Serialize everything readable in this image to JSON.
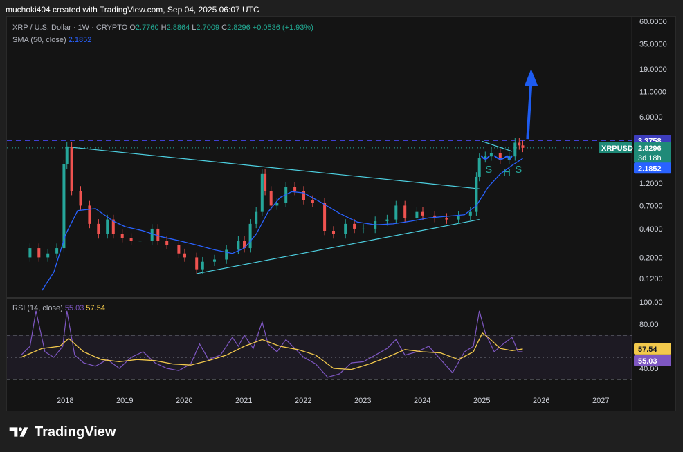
{
  "header": {
    "attribution": "muchoki404 created with TradingView.com, Sep 04, 2025 06:07 UTC"
  },
  "legend": {
    "symbol": "XRP / U.S. Dollar · 1W · CRYPTO",
    "o_label": "O",
    "o": "2.7760",
    "h_label": "H",
    "h": "2.8864",
    "l_label": "L",
    "l": "2.7009",
    "c_label": "C",
    "c": "2.8296",
    "change": "+0.0536 (+1.93%)",
    "sma_label": "SMA (50, close)",
    "sma": "2.1852"
  },
  "rsi_legend": {
    "label": "RSI (14, close)",
    "rsi": "55.03",
    "ma": "57.54"
  },
  "price_badges": {
    "resistance": "3.3758",
    "symbol": "XRPUSD",
    "price": "2.8296",
    "countdown": "3d 18h",
    "sma": "2.1852"
  },
  "rsi_badges": {
    "ma": "57.54",
    "rsi": "55.03"
  },
  "pattern_labels": [
    "S",
    "H",
    "S"
  ],
  "footer": {
    "brand": "TradingView"
  },
  "colors": {
    "up": "#26a69a",
    "down": "#ef5350",
    "sma": "#2962ff",
    "trend": "#4dd0e1",
    "rsi": "#7e57c2",
    "rsi_ma": "#f2c94c",
    "resistance": "#3f3fd1",
    "arrow": "#1e5cf0"
  },
  "chart_data": [
    {
      "type": "candlestick",
      "title": "XRP / U.S. Dollar · 1W · CRYPTO",
      "y_scale": "log",
      "y_ticks": [
        "60.0000",
        "35.0000",
        "19.0000",
        "11.0000",
        "6.0000",
        "1.2000",
        "0.7000",
        "0.4000",
        "0.2000",
        "0.1200"
      ],
      "x_ticks": [
        "2018",
        "2019",
        "2020",
        "2021",
        "2022",
        "2023",
        "2024",
        "2025",
        "2026",
        "2027"
      ],
      "series": [
        {
          "name": "XRP / U.S. Dollar",
          "x": [
            2017.25,
            2017.4,
            2017.55,
            2017.7,
            2017.85,
            2017.97,
            2018.02,
            2018.1,
            2018.25,
            2018.4,
            2018.55,
            2018.7,
            2018.8,
            2018.95,
            2019.1,
            2019.25,
            2019.45,
            2019.55,
            2019.7,
            2019.9,
            2020.0,
            2020.2,
            2020.3,
            2020.5,
            2020.7,
            2020.9,
            2021.0,
            2021.1,
            2021.2,
            2021.3,
            2021.35,
            2021.45,
            2021.55,
            2021.7,
            2021.85,
            2022.0,
            2022.15,
            2022.35,
            2022.5,
            2022.7,
            2022.85,
            2023.0,
            2023.2,
            2023.4,
            2023.55,
            2023.7,
            2023.9,
            2024.0,
            2024.2,
            2024.4,
            2024.6,
            2024.8,
            2024.9,
            2024.95,
            2025.05,
            2025.15,
            2025.3,
            2025.45,
            2025.55,
            2025.62,
            2025.68
          ],
          "close": [
            0.2,
            0.25,
            0.2,
            0.22,
            0.25,
            1.9,
            2.9,
            1.0,
            0.7,
            0.45,
            0.35,
            0.5,
            0.35,
            0.32,
            0.3,
            0.3,
            0.4,
            0.3,
            0.27,
            0.22,
            0.2,
            0.15,
            0.18,
            0.19,
            0.24,
            0.3,
            0.25,
            0.45,
            0.6,
            1.5,
            1.0,
            0.7,
            0.75,
            1.1,
            1.0,
            0.8,
            0.75,
            0.38,
            0.35,
            0.45,
            0.4,
            0.4,
            0.48,
            0.5,
            0.7,
            0.52,
            0.6,
            0.55,
            0.52,
            0.5,
            0.55,
            0.6,
            1.4,
            2.2,
            2.3,
            2.5,
            2.1,
            2.3,
            3.2,
            3.0,
            2.83
          ]
        },
        {
          "name": "SMA (50, close)",
          "x": [
            2017.6,
            2017.8,
            2018.0,
            2018.2,
            2018.5,
            2018.8,
            2019.0,
            2019.3,
            2019.6,
            2019.9,
            2020.2,
            2020.5,
            2020.8,
            2021.0,
            2021.2,
            2021.4,
            2021.6,
            2021.8,
            2022.0,
            2022.3,
            2022.6,
            2022.9,
            2023.2,
            2023.5,
            2023.8,
            2024.1,
            2024.4,
            2024.7,
            2024.9,
            2025.1,
            2025.3,
            2025.5,
            2025.68
          ],
          "values": [
            0.09,
            0.14,
            0.35,
            0.62,
            0.65,
            0.48,
            0.42,
            0.38,
            0.33,
            0.3,
            0.27,
            0.24,
            0.22,
            0.25,
            0.35,
            0.6,
            0.85,
            0.98,
            0.95,
            0.75,
            0.58,
            0.47,
            0.44,
            0.45,
            0.48,
            0.52,
            0.54,
            0.56,
            0.7,
            1.1,
            1.5,
            1.85,
            2.19
          ]
        }
      ],
      "annotations": {
        "horizontal_resistance": 3.3758,
        "last_price": 2.8296,
        "sma_last": 2.1852,
        "upper_trendline": [
          [
            2018.02,
            2.9
          ],
          [
            2024.95,
            1.05
          ]
        ],
        "lower_trendline": [
          [
            2020.2,
            0.135
          ],
          [
            2024.95,
            0.5
          ]
        ],
        "pattern": "Inverse head and shoulders"
      }
    },
    {
      "type": "line",
      "title": "RSI (14, close)",
      "y_ticks": [
        "100.00",
        "80.00",
        "40.00"
      ],
      "levels": [
        70,
        50,
        30
      ],
      "series": [
        {
          "name": "RSI",
          "x": [
            2017.25,
            2017.4,
            2017.5,
            2017.65,
            2017.8,
            2017.95,
            2018.02,
            2018.15,
            2018.3,
            2018.5,
            2018.7,
            2018.9,
            2019.1,
            2019.3,
            2019.5,
            2019.7,
            2019.9,
            2020.1,
            2020.25,
            2020.4,
            2020.6,
            2020.8,
            2020.9,
            2021.0,
            2021.15,
            2021.3,
            2021.4,
            2021.55,
            2021.7,
            2021.85,
            2022.0,
            2022.2,
            2022.4,
            2022.6,
            2022.8,
            2023.0,
            2023.2,
            2023.4,
            2023.55,
            2023.7,
            2023.9,
            2024.1,
            2024.3,
            2024.5,
            2024.7,
            2024.85,
            2024.95,
            2025.05,
            2025.2,
            2025.35,
            2025.5,
            2025.6,
            2025.68
          ],
          "values": [
            52,
            60,
            92,
            55,
            50,
            60,
            92,
            52,
            45,
            42,
            48,
            40,
            50,
            55,
            45,
            40,
            38,
            44,
            62,
            48,
            52,
            68,
            60,
            70,
            58,
            82,
            62,
            55,
            66,
            58,
            50,
            44,
            32,
            35,
            45,
            46,
            52,
            58,
            66,
            52,
            55,
            60,
            48,
            36,
            55,
            60,
            92,
            72,
            55,
            62,
            68,
            55,
            55.03
          ]
        },
        {
          "name": "RSI-based MA",
          "x": [
            2017.25,
            2017.6,
            2017.9,
            2018.05,
            2018.3,
            2018.6,
            2018.9,
            2019.2,
            2019.5,
            2019.8,
            2020.1,
            2020.4,
            2020.7,
            2021.0,
            2021.3,
            2021.6,
            2021.9,
            2022.2,
            2022.5,
            2022.8,
            2023.1,
            2023.4,
            2023.7,
            2024.0,
            2024.3,
            2024.6,
            2024.85,
            2025.0,
            2025.1,
            2025.3,
            2025.5,
            2025.68
          ],
          "values": [
            50,
            58,
            60,
            67,
            55,
            48,
            46,
            48,
            47,
            44,
            43,
            47,
            52,
            60,
            66,
            60,
            57,
            52,
            40,
            39,
            44,
            50,
            57,
            55,
            54,
            48,
            55,
            72,
            68,
            58,
            56,
            57.54
          ]
        }
      ]
    }
  ]
}
